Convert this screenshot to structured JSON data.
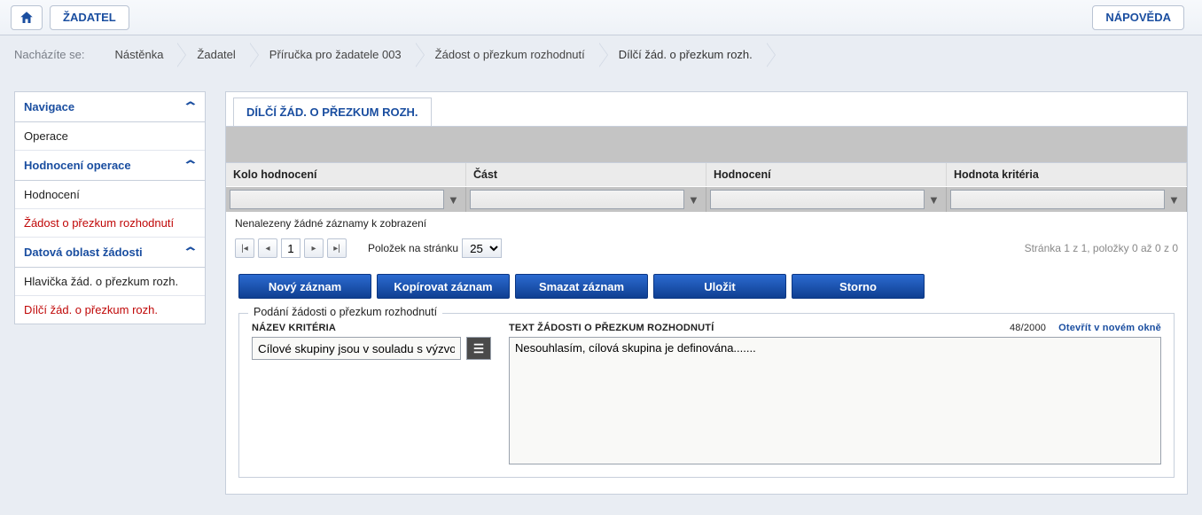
{
  "topbar": {
    "zadatel": "ŽADATEL",
    "napoveda": "NÁPOVĚDA"
  },
  "breadcrumb": {
    "label": "Nacházíte se:",
    "items": [
      "Nástěnka",
      "Žadatel",
      "Příručka pro žadatele 003",
      "Žádost o přezkum rozhodnutí",
      "Dílčí žád. o přezkum rozh."
    ]
  },
  "sidebar": {
    "nav_head": "Navigace",
    "nav_items": [
      "Operace"
    ],
    "hodn_head": "Hodnocení operace",
    "hodn_items": [
      {
        "label": "Hodnocení",
        "red": false
      },
      {
        "label": "Žádost o přezkum rozhodnutí",
        "red": true
      }
    ],
    "data_head": "Datová oblast žádosti",
    "data_items": [
      {
        "label": "Hlavička žád. o přezkum rozh.",
        "red": false
      },
      {
        "label": "Dílčí žád. o přezkum rozh.",
        "red": true
      }
    ]
  },
  "content": {
    "tab_title": "DÍLČÍ ŽÁD. O PŘEZKUM ROZH.",
    "grid": {
      "cols": [
        "Kolo hodnocení",
        "Část",
        "Hodnocení",
        "Hodnota kritéria"
      ],
      "empty_msg": "Nenalezeny žádné záznamy k zobrazení"
    },
    "pager": {
      "current": "1",
      "per_page_label": "Položek na stránku",
      "per_page_value": "25",
      "info": "Stránka 1 z 1, položky 0 až 0 z 0"
    },
    "actions": {
      "novy": "Nový záznam",
      "kopirovat": "Kopírovat záznam",
      "smazat": "Smazat záznam",
      "ulozit": "Uložit",
      "storno": "Storno"
    },
    "form": {
      "legend": "Podání žádosti o přezkum rozhodnutí",
      "nazev_krit_label": "NÁZEV KRITÉRIA",
      "nazev_krit_value": "Cílové skupiny jsou v souladu s výzvou",
      "text_label": "TEXT ŽÁDOSTI O PŘEZKUM ROZHODNUTÍ",
      "counter": "48/2000",
      "open_new": "Otevřít v novém okně",
      "text_value": "Nesouhlasím, cílová skupina je definována......."
    }
  }
}
